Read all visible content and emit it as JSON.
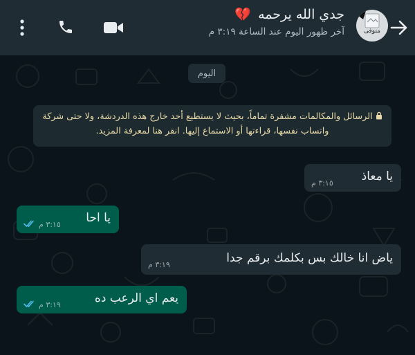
{
  "header": {
    "contact_name": "جدي الله يرحمه",
    "heart": "💔",
    "last_seen": "آخر ظهور اليوم عند الساعة ٣:١٩ م",
    "avatar_text": "متوفى",
    "icons": [
      "back-arrow-icon",
      "video-call-icon",
      "voice-call-icon",
      "more-options-icon"
    ]
  },
  "chat": {
    "date_label": "اليوم",
    "encryption_notice": "الرسائل والمكالمات مشفرة تماماً، بحيث لا يستطيع أحد خارج هذه الدردشة، ولا حتى شركة واتساب نفسها، قراءتها أو الاستماع إليها. انقر هنا لمعرفة المزيد.",
    "messages": [
      {
        "direction": "incoming",
        "text": "يا معاذ",
        "time": "٣:١٥ م"
      },
      {
        "direction": "outgoing",
        "text": "يا احا",
        "time": "٣:١٥ م",
        "status": "read"
      },
      {
        "direction": "incoming",
        "text": "ياض انا خالك بس بكلمك برقم جدا",
        "time": "٣:١٩ م"
      },
      {
        "direction": "outgoing",
        "text": "يعم اي الرعب ده",
        "time": "٣:١٩ م",
        "status": "read"
      }
    ]
  },
  "colors": {
    "header_bg": "#1f2c34",
    "chat_bg": "#0b141a",
    "incoming_bubble": "#202c33",
    "outgoing_bubble": "#005c4b",
    "read_ticks": "#53bdeb",
    "notice_text": "#e8d9a8"
  }
}
